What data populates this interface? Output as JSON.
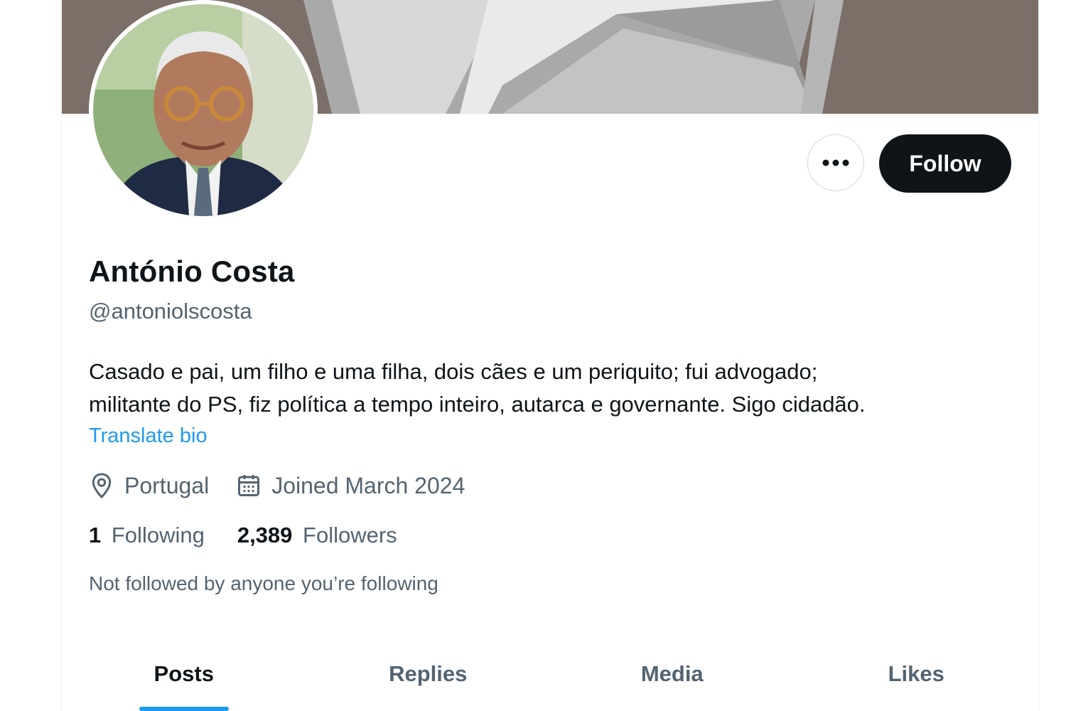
{
  "profile": {
    "name": "António Costa",
    "handle": "@antoniolscosta",
    "bio_line1": "Casado e pai, um filho e uma filha, dois cães e um periquito; fui advogado;",
    "bio_line2": "militante do PS, fiz política a tempo inteiro, autarca e governante. Sigo cidadão.",
    "translate_label": "Translate bio",
    "location": "Portugal",
    "joined": "Joined March 2024",
    "following_count": "1",
    "following_label": "Following",
    "followers_count": "2,389",
    "followers_label": "Followers",
    "not_followed": "Not followed by anyone you’re following"
  },
  "actions": {
    "follow_label": "Follow",
    "more_icon": "more-horizontal-icon"
  },
  "tabs": [
    {
      "label": "Posts",
      "active": true
    },
    {
      "label": "Replies",
      "active": false
    },
    {
      "label": "Media",
      "active": false
    },
    {
      "label": "Likes",
      "active": false
    }
  ],
  "colors": {
    "accent": "#1d9bf0",
    "text_primary": "#0f1419",
    "text_secondary": "#536471",
    "follow_bg": "#0f1419"
  }
}
